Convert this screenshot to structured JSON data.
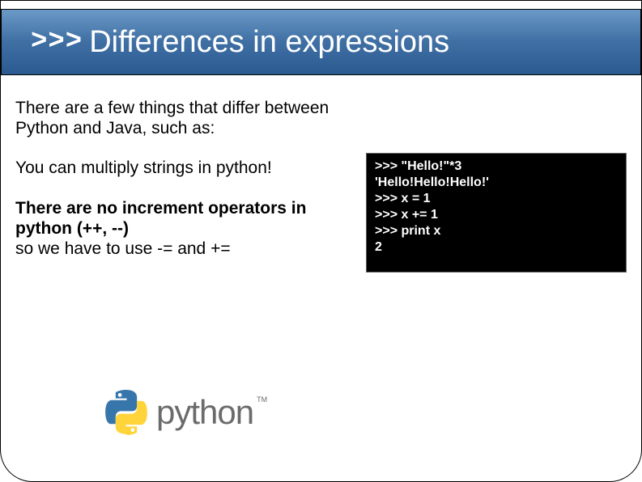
{
  "title": {
    "prefix": ">>>",
    "text": "Differences in expressions"
  },
  "body": {
    "intro": "There are a few things that differ between Python and Java, such as:",
    "line1": "You can multiply strings in python!",
    "line2_bold": "There are no increment operators in python (++, --)",
    "line2_rest": "so we have to use -= and +="
  },
  "terminal": {
    "lines": ">>> \"Hello!\"*3\n'Hello!Hello!Hello!'\n>>> x = 1\n>>> x += 1\n>>> print x\n2"
  },
  "logo": {
    "text": "python",
    "tm": "TM"
  }
}
